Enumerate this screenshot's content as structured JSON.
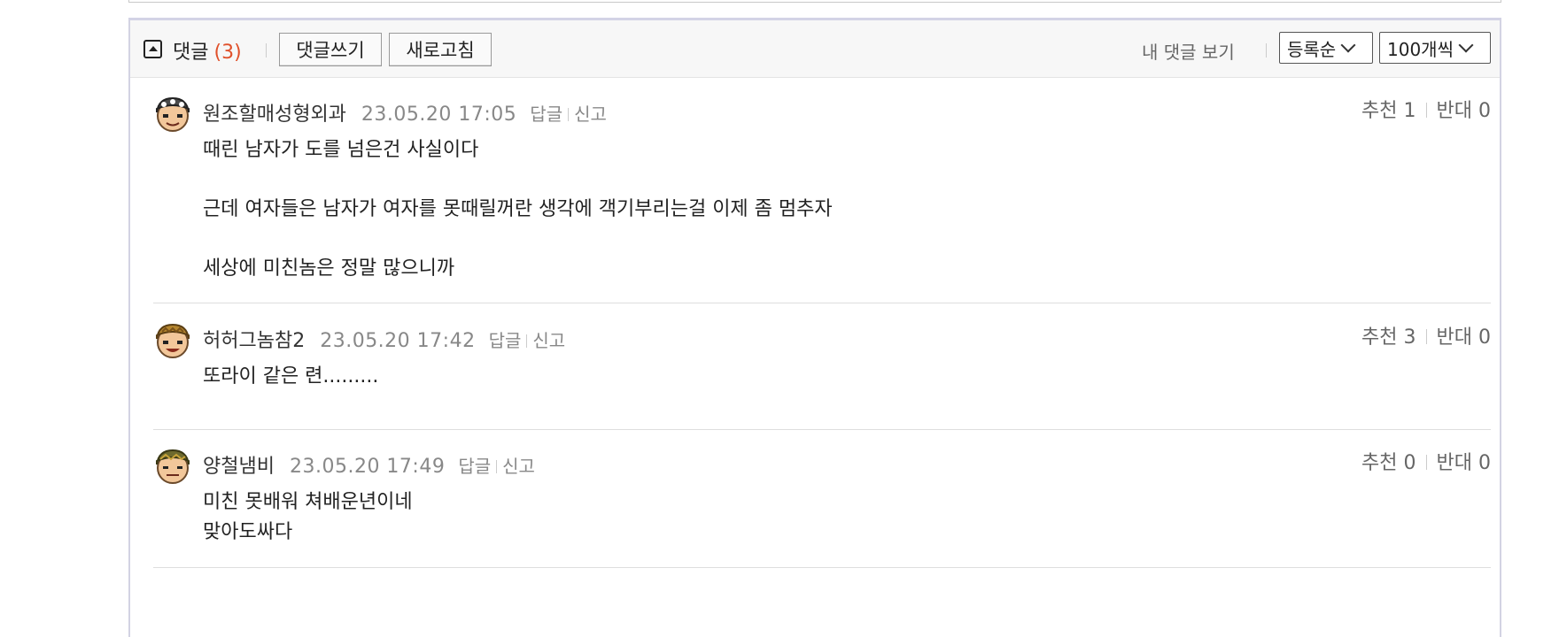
{
  "header": {
    "title": "댓글",
    "count": "(3)",
    "write_label": "댓글쓰기",
    "refresh_label": "새로고침",
    "my_comments_label": "내 댓글 보기",
    "sort_value": "등록순",
    "per_page_value": "100개씩"
  },
  "comments": [
    {
      "author": "원조할매성형외과",
      "date": "23.05.20 17:05",
      "reply": "답글",
      "report": "신고",
      "up": "추천 1",
      "down": "반대 0",
      "lines": [
        "때린 남자가 도를 넘은건 사실이다",
        "근데 여자들은 남자가 여자를 못때릴꺼란 생각에 객기부리는걸 이제 좀 멈추자",
        "세상에 미친놈은 정말 많으니까"
      ]
    },
    {
      "author": "허허그놈참2",
      "date": "23.05.20 17:42",
      "reply": "답글",
      "report": "신고",
      "up": "추천 3",
      "down": "반대 0",
      "lines": [
        "또라이 같은 련........."
      ]
    },
    {
      "author": "양철냄비",
      "date": "23.05.20 17:49",
      "reply": "답글",
      "report": "신고",
      "up": "추천 0",
      "down": "반대 0",
      "lines": [
        "미친 못배워 쳐배운년이네",
        "맞아도싸다"
      ]
    }
  ],
  "colors": {
    "count": "#e0512b",
    "meta": "#888888",
    "bar_bg": "#f7f7f7"
  },
  "icons": {
    "toggle": "collapse-up-icon",
    "avatar": "character-avatar-icon"
  }
}
